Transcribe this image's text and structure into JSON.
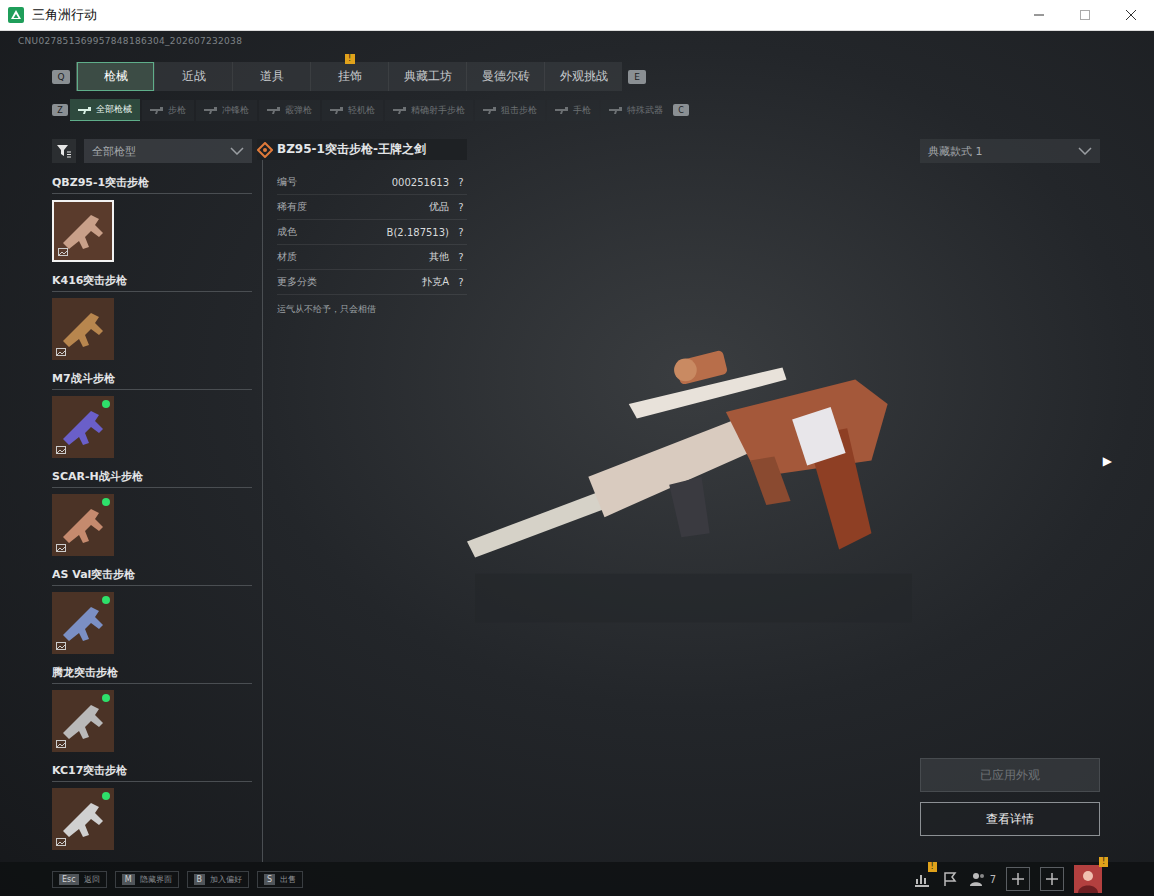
{
  "window": {
    "title": "三角洲行动"
  },
  "session_id": "CNU027851369957848186304_202607232038",
  "tab_keys": {
    "prev": "Q",
    "next": "E"
  },
  "tabs": [
    {
      "label": "枪械",
      "selected": true,
      "badge": ""
    },
    {
      "label": "近战",
      "selected": false,
      "badge": ""
    },
    {
      "label": "道具",
      "selected": false,
      "badge": ""
    },
    {
      "label": "挂饰",
      "selected": false,
      "badge": "!"
    },
    {
      "label": "典藏工坊",
      "selected": false,
      "badge": ""
    },
    {
      "label": "曼德尔砖",
      "selected": false,
      "badge": ""
    },
    {
      "label": "外观挑战",
      "selected": false,
      "badge": ""
    }
  ],
  "subtab_keys": {
    "prev": "Z",
    "next": "C"
  },
  "subtabs": [
    {
      "label": "全部枪械",
      "selected": true
    },
    {
      "label": "步枪",
      "selected": false
    },
    {
      "label": "冲锋枪",
      "selected": false
    },
    {
      "label": "霰弹枪",
      "selected": false
    },
    {
      "label": "轻机枪",
      "selected": false
    },
    {
      "label": "精确射手步枪",
      "selected": false
    },
    {
      "label": "狙击步枪",
      "selected": false
    },
    {
      "label": "手枪",
      "selected": false
    },
    {
      "label": "特殊武器",
      "selected": false
    }
  ],
  "filter": {
    "value": "全部枪型"
  },
  "guns": [
    {
      "name": "QBZ95-1突击步枪",
      "selected": true,
      "dot": false,
      "color": "#c9a089"
    },
    {
      "name": "K416突击步枪",
      "selected": false,
      "dot": false,
      "color": "#b8864e"
    },
    {
      "name": "M7战斗步枪",
      "selected": false,
      "dot": true,
      "color": "#6a5fc9"
    },
    {
      "name": "SCAR-H战斗步枪",
      "selected": false,
      "dot": true,
      "color": "#c58a6e"
    },
    {
      "name": "AS Val突击步枪",
      "selected": false,
      "dot": true,
      "color": "#7b8fc4"
    },
    {
      "name": "腾龙突击步枪",
      "selected": false,
      "dot": true,
      "color": "#b9b9b9"
    },
    {
      "name": "KC17突击步枪",
      "selected": false,
      "dot": true,
      "color": "#d0d0d0"
    }
  ],
  "detail": {
    "title": "BZ95-1突击步枪-王牌之剑",
    "rows": [
      {
        "label": "编号",
        "value": "000251613",
        "help": "?"
      },
      {
        "label": "稀有度",
        "value": "优品",
        "help": "?"
      },
      {
        "label": "成色",
        "value": "B(2.187513)",
        "help": "?"
      },
      {
        "label": "材质",
        "value": "其他",
        "help": "?"
      },
      {
        "label": "更多分类",
        "value": "扑克A",
        "help": "?"
      }
    ],
    "note": "运气从不给予，只会相借"
  },
  "style_select": {
    "value": "典藏款式 1"
  },
  "next_arrow": "▶",
  "buttons": [
    {
      "label": "已应用外观",
      "disabled": true
    },
    {
      "label": "查看详情",
      "disabled": false
    }
  ],
  "hotkeys": [
    {
      "key": "Esc",
      "label": "返回"
    },
    {
      "key": "M",
      "label": "隐藏界面"
    },
    {
      "key": "B",
      "label": "加入偏好"
    },
    {
      "key": "S",
      "label": "出售"
    }
  ],
  "status": {
    "stats_badge": "!",
    "friends_count": "7",
    "avatar_badge": "!"
  }
}
